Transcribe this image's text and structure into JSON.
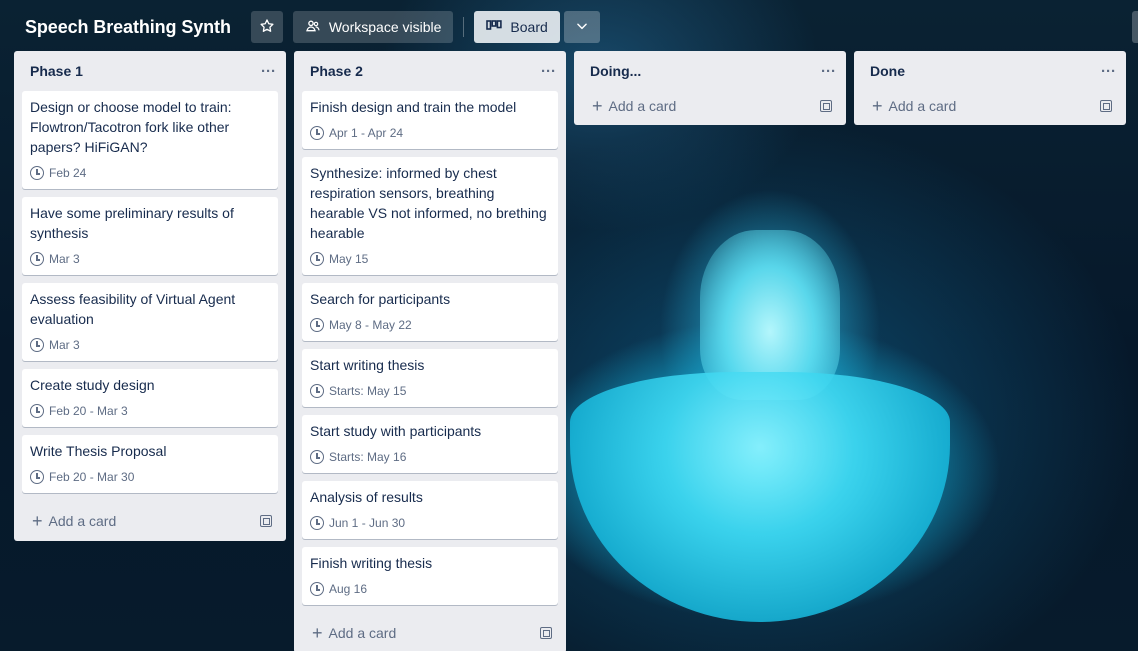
{
  "header": {
    "board_title": "Speech Breathing Synth",
    "visibility_label": "Workspace visible",
    "view_label": "Board"
  },
  "lists": [
    {
      "title": "Phase 1",
      "cards": [
        {
          "title": "Design or choose model to train: Flowtron/Tacotron fork like other papers? HiFiGAN?",
          "date": "Feb 24"
        },
        {
          "title": "Have some preliminary results of synthesis",
          "date": "Mar 3"
        },
        {
          "title": "Assess feasibility of Virtual Agent evaluation",
          "date": "Mar 3"
        },
        {
          "title": "Create study design",
          "date": "Feb 20 - Mar 3"
        },
        {
          "title": "Write Thesis Proposal",
          "date": "Feb 20 - Mar 30"
        }
      ],
      "add_label": "Add a card"
    },
    {
      "title": "Phase 2",
      "cards": [
        {
          "title": "Finish design and train the model",
          "date": "Apr 1 - Apr 24"
        },
        {
          "title": "Synthesize: informed by chest respiration sensors, breathing hearable VS not informed, no brething hearable",
          "date": "May 15"
        },
        {
          "title": "Search for participants",
          "date": "May 8 - May 22"
        },
        {
          "title": "Start writing thesis",
          "date": "Starts: May 15"
        },
        {
          "title": "Start study with participants",
          "date": "Starts: May 16"
        },
        {
          "title": "Analysis of results",
          "date": "Jun 1 - Jun 30"
        },
        {
          "title": "Finish writing thesis",
          "date": "Aug 16"
        }
      ],
      "add_label": "Add a card"
    },
    {
      "title": "Doing...",
      "cards": [],
      "add_label": "Add a card"
    },
    {
      "title": "Done",
      "cards": [],
      "add_label": "Add a card"
    }
  ]
}
